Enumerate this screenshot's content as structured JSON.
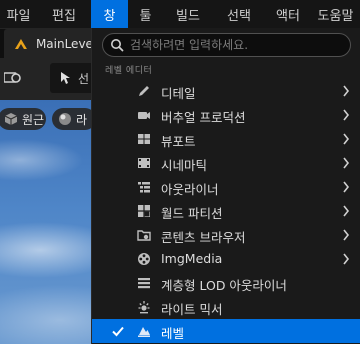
{
  "menubar": {
    "items": [
      {
        "label": "파일"
      },
      {
        "label": "편집"
      },
      {
        "label": "창"
      },
      {
        "label": "툴"
      },
      {
        "label": "빌드"
      },
      {
        "label": "선택"
      },
      {
        "label": "액터"
      },
      {
        "label": "도움말"
      }
    ]
  },
  "tab": {
    "label": "MainLevel"
  },
  "toolbar": {
    "select_mode_label": "선"
  },
  "viewport": {
    "perspective_label": "원근",
    "lit_label": "라"
  },
  "dropdown": {
    "search_placeholder": "검색하려면 입력하세요.",
    "section_label": "레벨 에디터",
    "items": [
      {
        "label": "디테일",
        "icon": "pencil-icon",
        "submenu": true,
        "checked": false
      },
      {
        "label": "버추얼 프로덕션",
        "icon": "camera-icon",
        "submenu": true,
        "checked": false
      },
      {
        "label": "뷰포트",
        "icon": "viewport-layout-icon",
        "submenu": true,
        "checked": false
      },
      {
        "label": "시네마틱",
        "icon": "film-icon",
        "submenu": true,
        "checked": false
      },
      {
        "label": "아웃라이너",
        "icon": "outliner-icon",
        "submenu": true,
        "checked": false
      },
      {
        "label": "월드 파티션",
        "icon": "world-partition-icon",
        "submenu": true,
        "checked": false
      },
      {
        "label": "콘텐츠 브라우저",
        "icon": "folder-icon",
        "submenu": true,
        "checked": false
      },
      {
        "label": "ImgMedia",
        "icon": "media-icon",
        "submenu": true,
        "checked": false
      },
      {
        "label": "계층형 LOD 아웃라이너",
        "icon": "hlod-icon",
        "submenu": false,
        "checked": false
      },
      {
        "label": "라이트 믹서",
        "icon": "light-icon",
        "submenu": false,
        "checked": false
      },
      {
        "label": "레벨",
        "icon": "level-icon",
        "submenu": false,
        "checked": true
      }
    ]
  },
  "colors": {
    "accent": "#0070e0",
    "menu_bg": "#1a1a1a",
    "logo": "#e8a21a"
  }
}
